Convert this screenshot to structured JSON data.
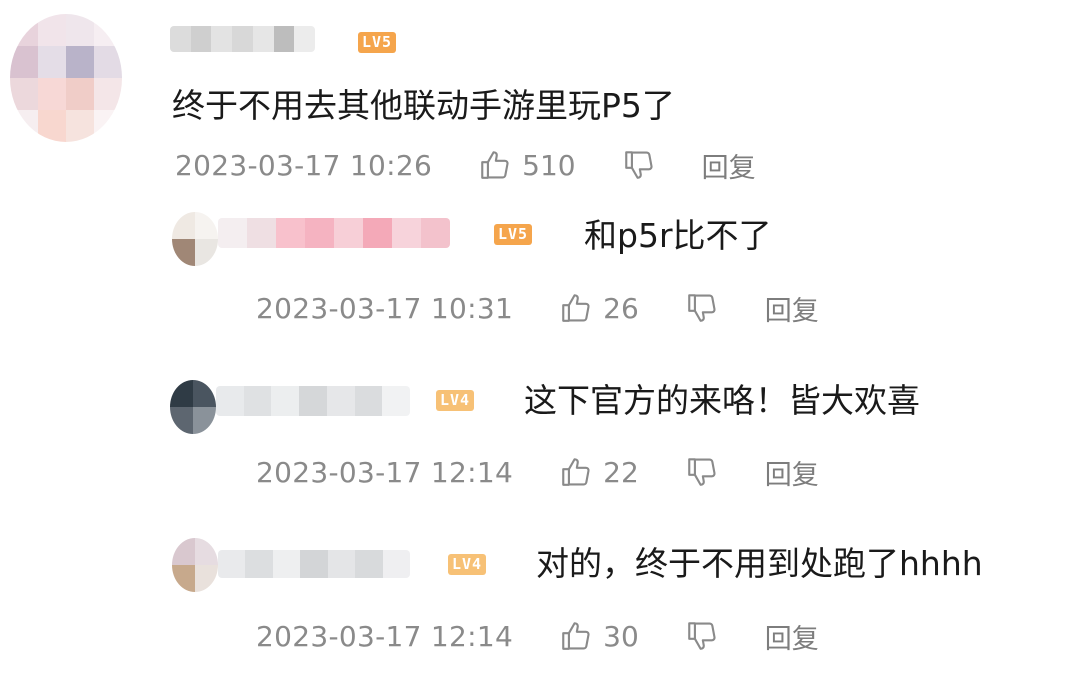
{
  "comments": [
    {
      "level": "LV5",
      "text": "终于不用去其他联动手游里玩P5了",
      "timestamp": "2023-03-17 10:26",
      "likes": "510",
      "reply_label": "回复"
    },
    {
      "level": "LV5",
      "text": "和p5r比不了",
      "timestamp": "2023-03-17 10:31",
      "likes": "26",
      "reply_label": "回复"
    },
    {
      "level": "LV4",
      "text": "这下官方的来咯！皆大欢喜",
      "timestamp": "2023-03-17 12:14",
      "likes": "22",
      "reply_label": "回复"
    },
    {
      "level": "LV4",
      "text": "对的，终于不用到处跑了hhhh",
      "timestamp": "2023-03-17 12:14",
      "likes": "30",
      "reply_label": "回复"
    }
  ],
  "colors": {
    "badge_lv5": "#f5a54c",
    "badge_lv4": "#f7c176",
    "meta_text": "#8a8a8a",
    "body_text": "#1a1a1a"
  },
  "icons": {
    "like": "thumbs-up-outline",
    "dislike": "thumbs-down-outline"
  }
}
